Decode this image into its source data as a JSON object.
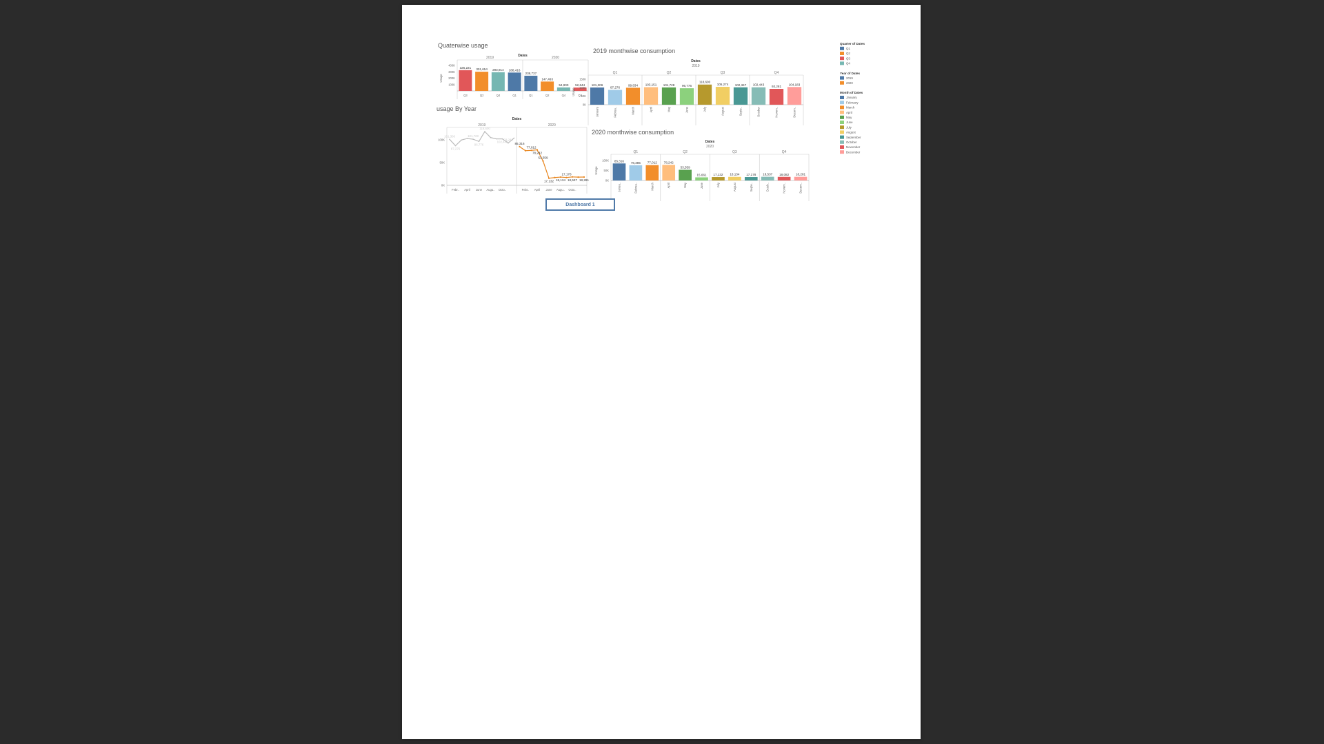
{
  "dashboard": {
    "button_label": "Dashboard 1",
    "legends": [
      {
        "title": "Quarter of Dates",
        "items": [
          {
            "label": "Q1",
            "color": "#4e79a7"
          },
          {
            "label": "Q2",
            "color": "#f28e2b"
          },
          {
            "label": "Q3",
            "color": "#e15759"
          },
          {
            "label": "Q4",
            "color": "#76b7b2"
          }
        ]
      },
      {
        "title": "Year of Dates",
        "items": [
          {
            "label": "2019",
            "color": "#4e79a7"
          },
          {
            "label": "2020",
            "color": "#f28e2b"
          }
        ]
      },
      {
        "title": "Month of Dates",
        "items": [
          {
            "label": "January",
            "color": "#4e79a7"
          },
          {
            "label": "February",
            "color": "#a0cbe8"
          },
          {
            "label": "March",
            "color": "#f28e2b"
          },
          {
            "label": "April",
            "color": "#ffbe7d"
          },
          {
            "label": "May",
            "color": "#59a14f"
          },
          {
            "label": "June",
            "color": "#8cd17d"
          },
          {
            "label": "July",
            "color": "#b6992d"
          },
          {
            "label": "August",
            "color": "#f1ce63"
          },
          {
            "label": "September",
            "color": "#499894"
          },
          {
            "label": "October",
            "color": "#86bcb6"
          },
          {
            "label": "November",
            "color": "#e15759"
          },
          {
            "label": "December",
            "color": "#ff9d9a"
          }
        ]
      }
    ]
  },
  "chart_data": [
    {
      "id": "quarter",
      "type": "bar",
      "title": "Quaterwise usage",
      "column_header": "Dates",
      "ylabel": "Usage",
      "ylim": [
        0,
        400000
      ],
      "yticks": [
        "100K",
        "200K",
        "300K",
        "400K"
      ],
      "groups": [
        {
          "label": "2019",
          "bars": [
            {
              "category": "Q3",
              "value": 326221,
              "label": "326,221",
              "color": "#e15759"
            },
            {
              "category": "Q2",
              "value": 301654,
              "label": "301,654",
              "color": "#f28e2b"
            },
            {
              "category": "Q4",
              "value": 293914,
              "label": "293,914",
              "color": "#76b7b2"
            },
            {
              "category": "Q1",
              "value": 288416,
              "label": "288,416",
              "color": "#4e79a7"
            }
          ]
        },
        {
          "label": "2020",
          "bars": [
            {
              "category": "Q1",
              "value": 238737,
              "label": "238,737",
              "color": "#4e79a7"
            },
            {
              "category": "Q2",
              "value": 147463,
              "label": "147,463",
              "color": "#f28e2b"
            },
            {
              "category": "Q4",
              "value": 54900,
              "label": "54,900",
              "color": "#76b7b2"
            },
            {
              "category": "Q3",
              "value": 52644,
              "label": "52,644",
              "color": "#e15759"
            }
          ]
        }
      ]
    },
    {
      "id": "m2019",
      "type": "bar",
      "title": "2019 monthwise consumption",
      "column_header": "Dates",
      "subheader": "2019",
      "ylabel": "Usage",
      "ylim": [
        0,
        150000
      ],
      "yticks": [
        "0K",
        "50K",
        "100K",
        "150K"
      ],
      "quarters": [
        "Q1",
        "Q2",
        "Q3",
        "Q4"
      ],
      "bars": [
        {
          "category": "January",
          "value": 101306,
          "label": "101,306",
          "color": "#4e79a7"
        },
        {
          "category": "Februa..",
          "value": 87276,
          "label": "87,276",
          "color": "#a0cbe8"
        },
        {
          "category": "March",
          "value": 99834,
          "label": "99,834",
          "color": "#f28e2b"
        },
        {
          "category": "April",
          "value": 103151,
          "label": "103,151",
          "color": "#ffbe7d"
        },
        {
          "category": "May",
          "value": 101728,
          "label": "101,728",
          "color": "#59a14f"
        },
        {
          "category": "June",
          "value": 96776,
          "label": "96,776",
          "color": "#8cd17d"
        },
        {
          "category": "July",
          "value": 118600,
          "label": "118,600",
          "color": "#b6992d"
        },
        {
          "category": "August",
          "value": 105274,
          "label": "105,274",
          "color": "#f1ce63"
        },
        {
          "category": "Septe..",
          "value": 102347,
          "label": "102,347",
          "color": "#499894"
        },
        {
          "category": "October",
          "value": 102443,
          "label": "102,443",
          "color": "#86bcb6"
        },
        {
          "category": "Novem..",
          "value": 93281,
          "label": "93,281",
          "color": "#e15759"
        },
        {
          "category": "Decem..",
          "value": 104183,
          "label": "104,183",
          "color": "#ff9d9a"
        }
      ]
    },
    {
      "id": "m2020",
      "type": "bar",
      "title": "2020 monthwise consumption",
      "column_header": "Dates",
      "subheader": "2020",
      "ylabel": "Usage",
      "ylim": [
        0,
        100000
      ],
      "yticks": [
        "0K",
        "50K",
        "100K"
      ],
      "quarters": [
        "Q1",
        "Q2",
        "Q3",
        "Q4"
      ],
      "bars": [
        {
          "category": "Janua..",
          "value": 85316,
          "label": "85,316",
          "color": "#4e79a7"
        },
        {
          "category": "Februa..",
          "value": 76385,
          "label": "76,385",
          "color": "#a0cbe8"
        },
        {
          "category": "March",
          "value": 77012,
          "label": "77,012",
          "color": "#f28e2b"
        },
        {
          "category": "April",
          "value": 78242,
          "label": "78,242",
          "color": "#ffbe7d"
        },
        {
          "category": "May",
          "value": 53559,
          "label": "53,559",
          "color": "#59a14f"
        },
        {
          "category": "June",
          "value": 15661,
          "label": "15,661",
          "color": "#8cd17d"
        },
        {
          "category": "July",
          "value": 17132,
          "label": "17,132",
          "color": "#b6992d"
        },
        {
          "category": "August",
          "value": 18134,
          "label": "18,134",
          "color": "#f1ce63"
        },
        {
          "category": "Septe..",
          "value": 17178,
          "label": "17,178",
          "color": "#499894"
        },
        {
          "category": "Octob..",
          "value": 18537,
          "label": "18,537",
          "color": "#86bcb6"
        },
        {
          "category": "Novem..",
          "value": 18082,
          "label": "18,082",
          "color": "#e15759"
        },
        {
          "category": "Decem..",
          "value": 18281,
          "label": "18,281",
          "color": "#ff9d9a"
        }
      ]
    },
    {
      "id": "year",
      "type": "line",
      "title": "usage By Year",
      "column_header": "Dates",
      "ylim": [
        0,
        120000
      ],
      "yticks": [
        "0K",
        "50K",
        "100K"
      ],
      "xticks": [
        "Febr..",
        "April",
        "June",
        "Augu..",
        "Octo.."
      ],
      "series": [
        {
          "name": "2019",
          "color": "#bbbbbb",
          "faded": true,
          "values": [
            101306,
            87276,
            99834,
            103151,
            101728,
            96776,
            118600,
            105274,
            102347,
            102443,
            93281,
            104183
          ],
          "point_labels": [
            "101,306",
            "87,276",
            "",
            "",
            "101,728",
            "96,776",
            "118,600",
            "",
            "",
            "102,443",
            "93,281",
            ""
          ]
        },
        {
          "name": "2020",
          "color": "#e8851d",
          "faded": false,
          "values": [
            85316,
            76385,
            77012,
            78242,
            53559,
            15661,
            17132,
            18134,
            17178,
            18537,
            18082,
            18281
          ],
          "point_labels": [
            "85,316",
            "",
            "77,012",
            "78,242",
            "53,559",
            "17,132",
            "",
            "18,134",
            "17,178",
            "18,537",
            "",
            "18,281"
          ]
        }
      ]
    }
  ]
}
